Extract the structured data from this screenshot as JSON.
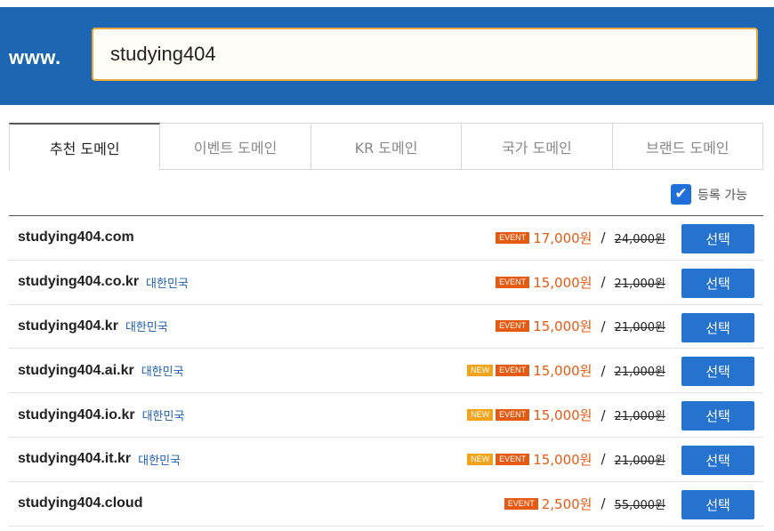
{
  "search": {
    "prefix": "www.",
    "value": "studying404"
  },
  "tabs": [
    {
      "label": "추천 도메인",
      "active": true
    },
    {
      "label": "이벤트 도메인",
      "active": false
    },
    {
      "label": "KR 도메인",
      "active": false
    },
    {
      "label": "국가 도메인",
      "active": false
    },
    {
      "label": "브랜드 도메인",
      "active": false
    }
  ],
  "filter": {
    "label": "등록 가능",
    "checked": true,
    "icon": "checkmark-icon"
  },
  "colors": {
    "header": "#1c66b4",
    "accent": "#2572cf",
    "event": "#e75a12",
    "new": "#f4a41b",
    "country": "#1e5fb4"
  },
  "results": [
    {
      "domain": "studying404.com",
      "country": "",
      "new_badge": "",
      "event_badge": "EVENT",
      "sale_price": "17,000원",
      "slash": "/",
      "original_price": "24,000원",
      "button": "선택"
    },
    {
      "domain": "studying404.co.kr",
      "country": "대한민국",
      "new_badge": "",
      "event_badge": "EVENT",
      "sale_price": "15,000원",
      "slash": "/",
      "original_price": "21,000원",
      "button": "선택"
    },
    {
      "domain": "studying404.kr",
      "country": "대한민국",
      "new_badge": "",
      "event_badge": "EVENT",
      "sale_price": "15,000원",
      "slash": "/",
      "original_price": "21,000원",
      "button": "선택"
    },
    {
      "domain": "studying404.ai.kr",
      "country": "대한민국",
      "new_badge": "NEW",
      "event_badge": "EVENT",
      "sale_price": "15,000원",
      "slash": "/",
      "original_price": "21,000원",
      "button": "선택"
    },
    {
      "domain": "studying404.io.kr",
      "country": "대한민국",
      "new_badge": "NEW",
      "event_badge": "EVENT",
      "sale_price": "15,000원",
      "slash": "/",
      "original_price": "21,000원",
      "button": "선택"
    },
    {
      "domain": "studying404.it.kr",
      "country": "대한민국",
      "new_badge": "NEW",
      "event_badge": "EVENT",
      "sale_price": "15,000원",
      "slash": "/",
      "original_price": "21,000원",
      "button": "선택"
    },
    {
      "domain": "studying404.cloud",
      "country": "",
      "new_badge": "",
      "event_badge": "EVENT",
      "sale_price": "2,500원",
      "slash": "/",
      "original_price": "55,000원",
      "button": "선택"
    }
  ]
}
